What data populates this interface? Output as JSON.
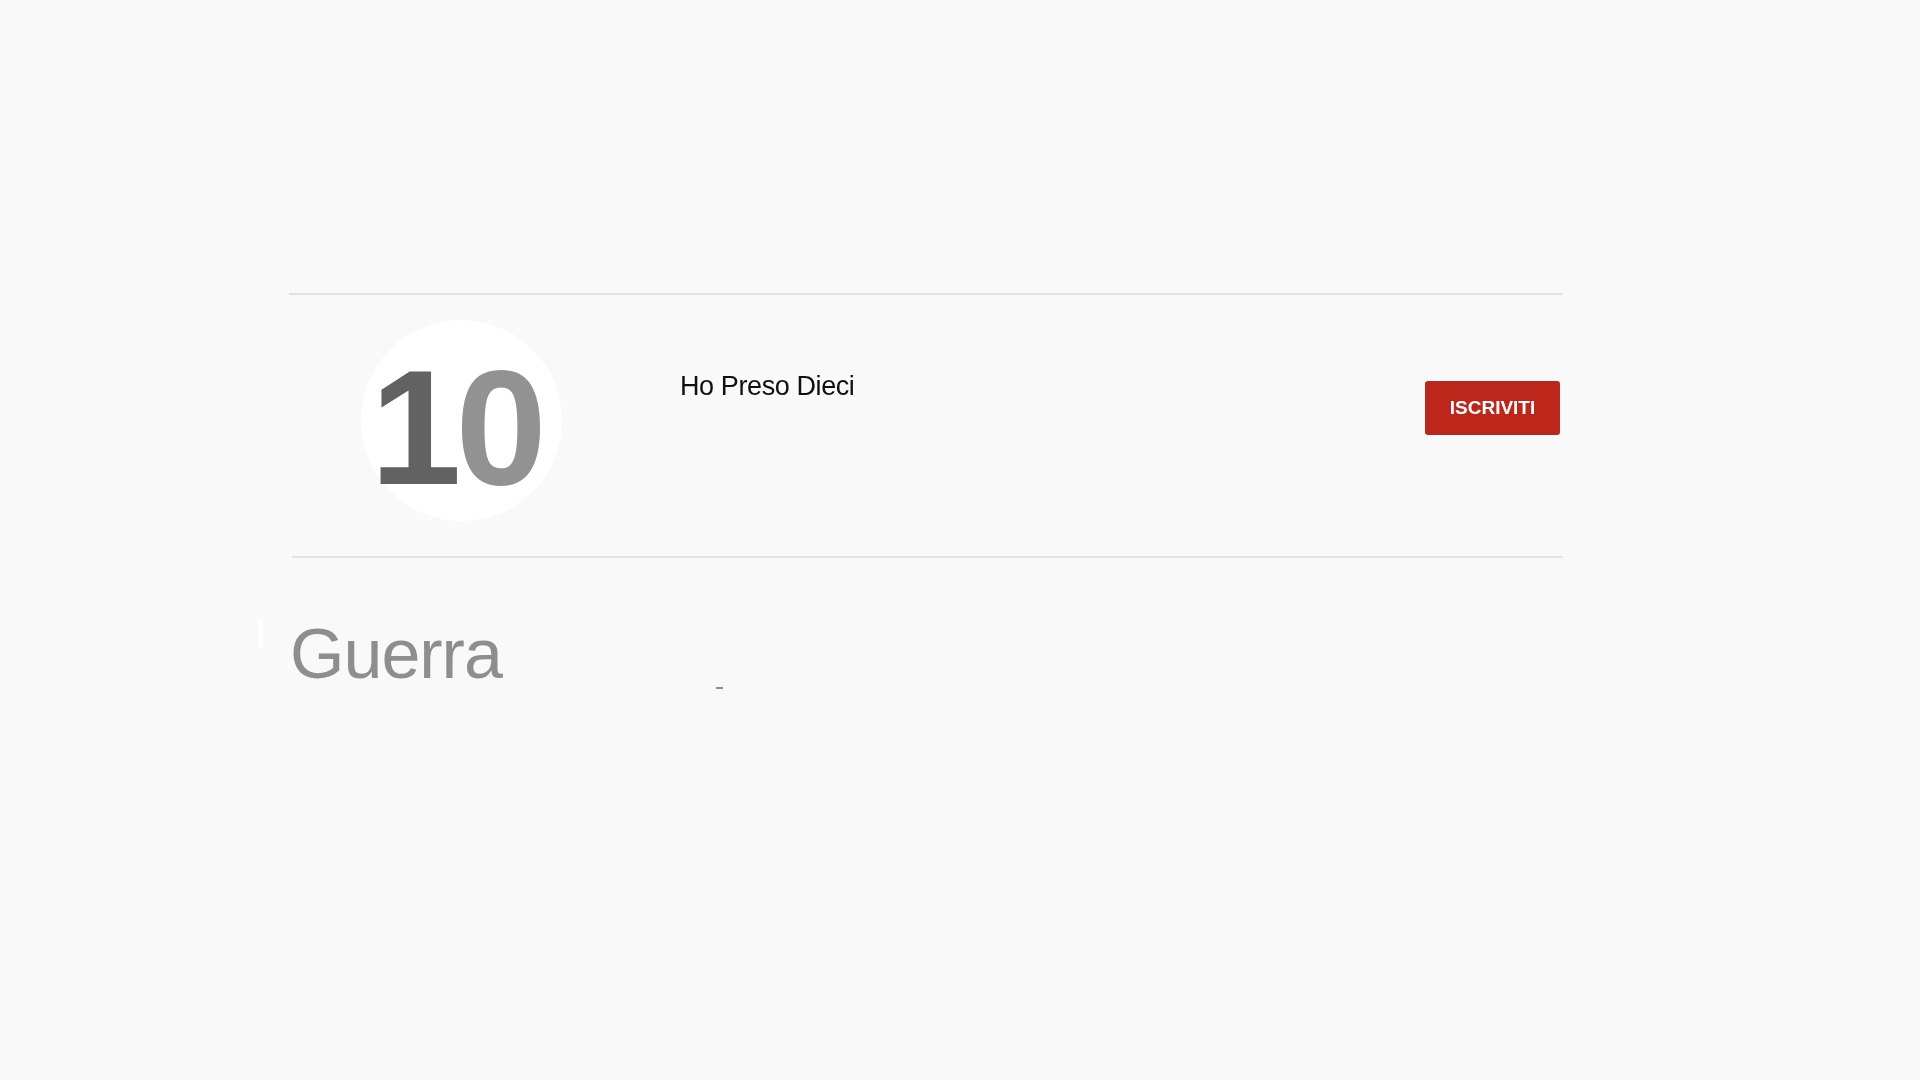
{
  "channel": {
    "logo_text": "10",
    "name": "Ho Preso Dieci",
    "subscribe_button": "ISCRIVITI"
  },
  "section": {
    "title": "Guerra"
  }
}
